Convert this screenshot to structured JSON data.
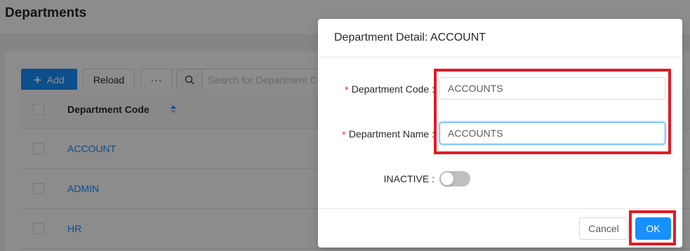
{
  "page": {
    "title": "Departments"
  },
  "toolbar": {
    "add_label": "Add",
    "reload_label": "Reload",
    "more_label": "···",
    "search_placeholder": "Search for Department Code"
  },
  "table": {
    "columns": [
      "Department Code"
    ],
    "rows": [
      "ACCOUNT",
      "ADMIN",
      "HR"
    ]
  },
  "modal": {
    "title": "Department Detail: ACCOUNT",
    "fields": {
      "code_label": "Department Code :",
      "code_value": "ACCOUNTS",
      "name_label": "Department Name :",
      "name_value": "ACCOUNTS",
      "inactive_label": "INACTIVE :",
      "required_mark": "*"
    },
    "inactive": false,
    "cancel_label": "Cancel",
    "ok_label": "OK"
  },
  "colors": {
    "primary": "#1890ff",
    "highlight": "#e01b24",
    "required": "#f5222d"
  }
}
